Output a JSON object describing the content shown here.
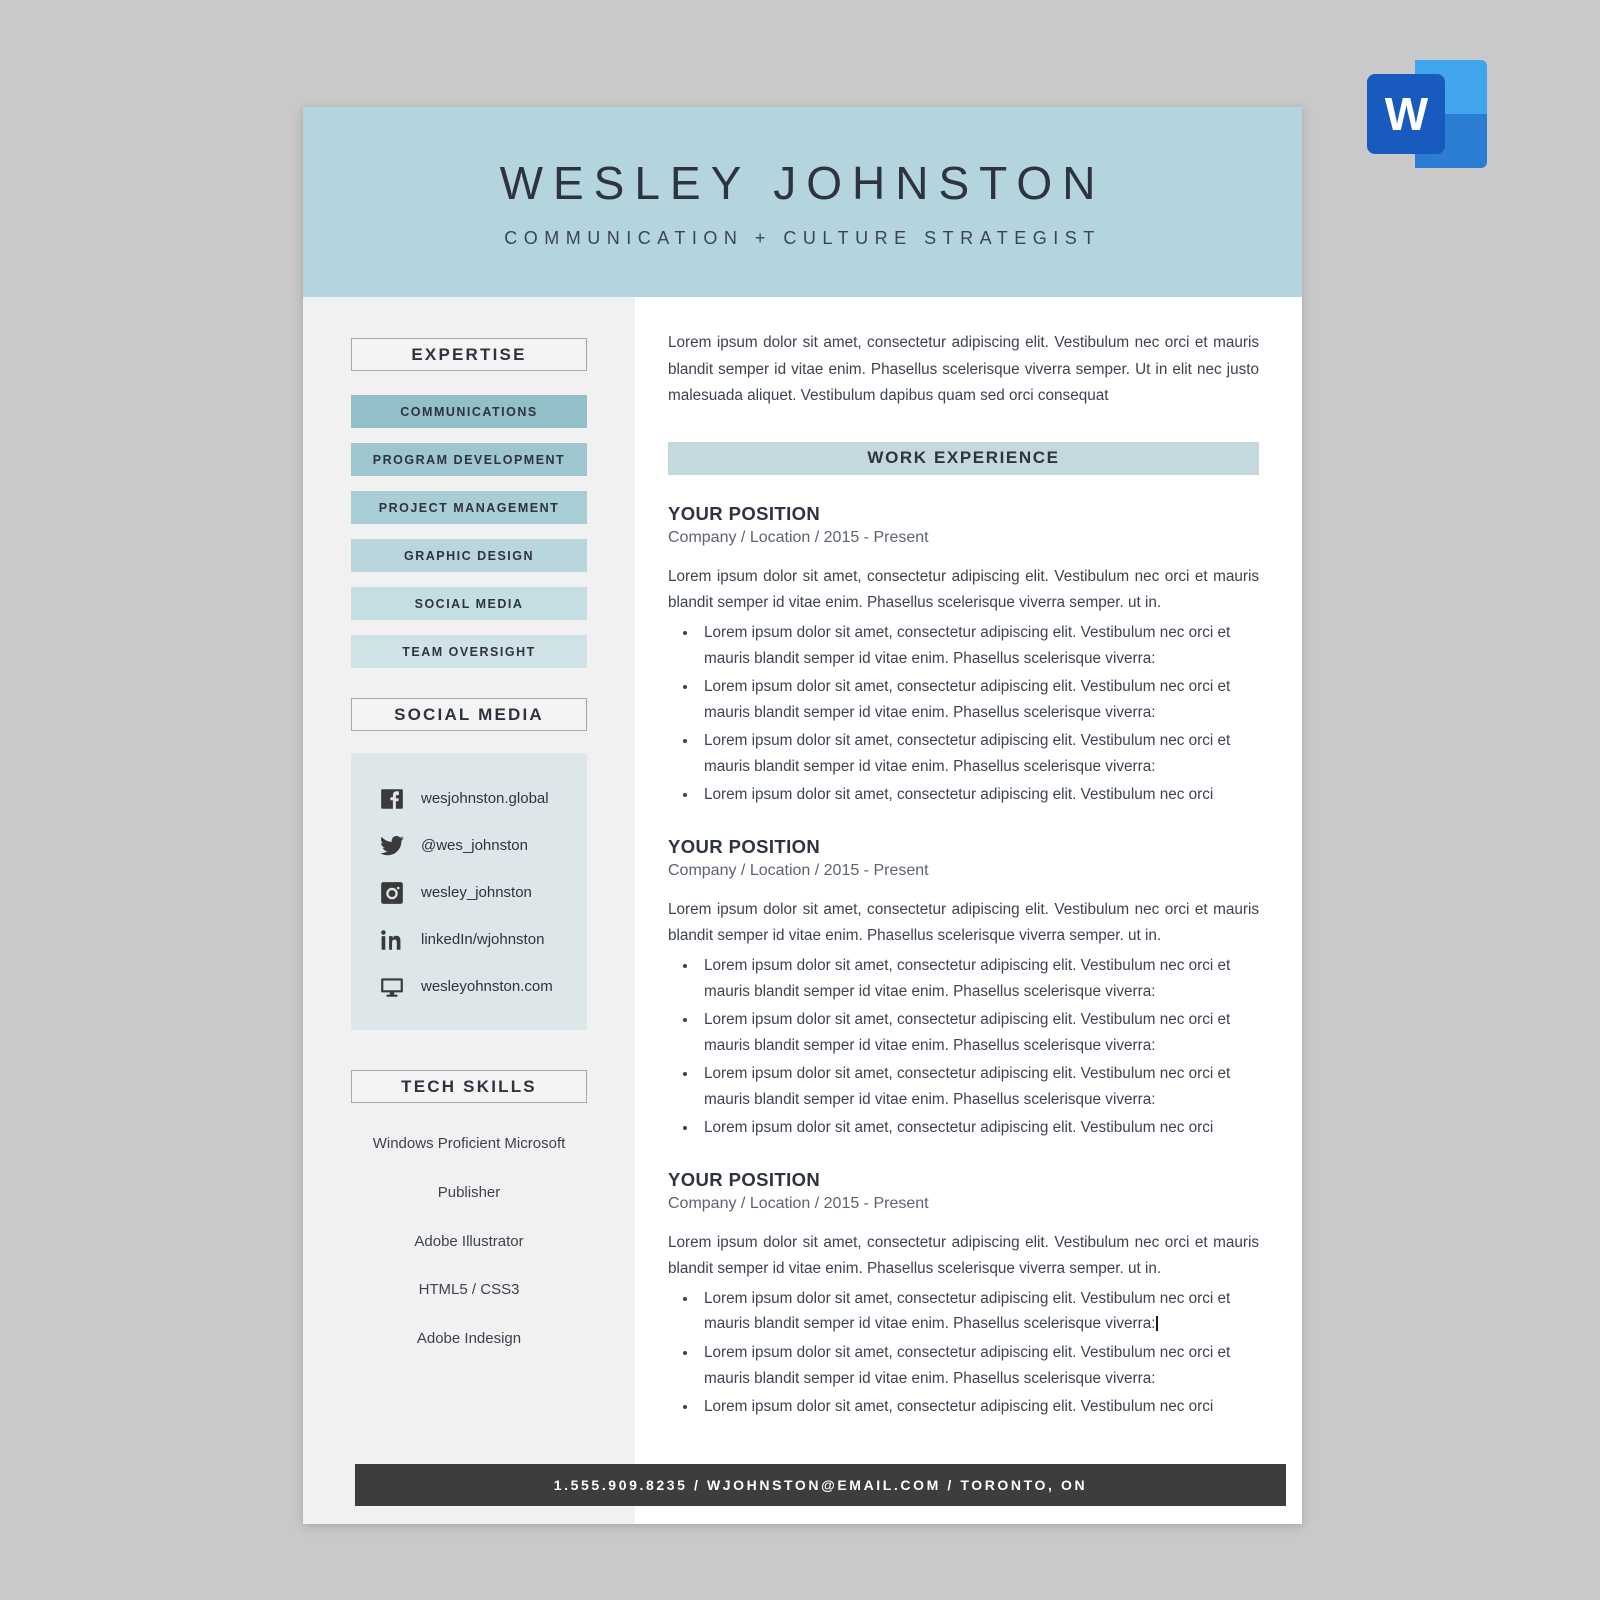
{
  "app_icon": {
    "name": "word-icon",
    "letter": "W"
  },
  "header": {
    "name": "WESLEY JOHNSTON",
    "subtitle": "COMMUNICATION + CULTURE STRATEGIST",
    "bg_color": "#b4d5dd"
  },
  "sidebar": {
    "expertise": {
      "heading": "EXPERTISE",
      "items": [
        {
          "label": "COMMUNICATIONS",
          "color": "#93bfc9"
        },
        {
          "label": "PROGRAM DEVELOPMENT",
          "color": "#9dc6cf"
        },
        {
          "label": "PROJECT MANAGEMENT",
          "color": "#a9ced5"
        },
        {
          "label": "GRAPHIC DESIGN",
          "color": "#b8d6dc"
        },
        {
          "label": "SOCIAL MEDIA",
          "color": "#c5dee3"
        },
        {
          "label": "TEAM OVERSIGHT",
          "color": "#cfe3e7"
        }
      ]
    },
    "social_media": {
      "heading": "SOCIAL MEDIA",
      "box_color": "#dde6e9",
      "items": [
        {
          "icon": "facebook-icon",
          "label": "wesjohnston.global"
        },
        {
          "icon": "twitter-icon",
          "label": "@wes_johnston"
        },
        {
          "icon": "instagram-icon",
          "label": "wesley_johnston"
        },
        {
          "icon": "linkedin-icon",
          "label": "linkedIn/wjohnston"
        },
        {
          "icon": "website-icon",
          "label": "wesleyohnston.com"
        }
      ]
    },
    "tech_skills": {
      "heading": "TECH SKILLS",
      "items": [
        "Windows Proficient Microsoft",
        "Publisher",
        "Adobe Illustrator",
        "HTML5 / CSS3",
        "Adobe Indesign"
      ]
    }
  },
  "main": {
    "intro": "Lorem ipsum dolor sit amet, consectetur adipiscing elit. Vestibulum nec orci et mauris blandit semper id vitae enim. Phasellus scelerisque viverra semper. Ut in elit nec justo malesuada aliquet. Vestibulum dapibus quam sed orci consequat",
    "work_heading": "WORK EXPERIENCE",
    "work_heading_color": "#c3d9de",
    "jobs": [
      {
        "title": "YOUR POSITION",
        "meta": "Company / Location / 2015 - Present",
        "description": "Lorem ipsum dolor sit amet, consectetur adipiscing elit. Vestibulum nec orci et mauris blandit semper id vitae enim. Phasellus scelerisque viverra semper. ut in.",
        "bullets": [
          "Lorem ipsum dolor sit amet, consectetur adipiscing elit. Vestibulum nec orci et mauris blandit semper id vitae enim. Phasellus scelerisque viverra:",
          "Lorem ipsum dolor sit amet, consectetur adipiscing elit. Vestibulum nec orci et mauris blandit semper id vitae enim. Phasellus scelerisque viverra:",
          "Lorem ipsum dolor sit amet, consectetur adipiscing elit. Vestibulum nec orci et mauris blandit semper id vitae enim. Phasellus scelerisque viverra:",
          "Lorem ipsum dolor sit amet, consectetur adipiscing elit. Vestibulum nec orci"
        ]
      },
      {
        "title": "YOUR POSITION",
        "meta": "Company / Location / 2015 - Present",
        "description": "Lorem ipsum dolor sit amet, consectetur adipiscing elit. Vestibulum nec orci et mauris blandit semper id vitae enim. Phasellus scelerisque viverra semper. ut in.",
        "bullets": [
          "Lorem ipsum dolor sit amet, consectetur adipiscing elit. Vestibulum nec orci et mauris blandit semper id vitae enim. Phasellus scelerisque viverra:",
          "Lorem ipsum dolor sit amet, consectetur adipiscing elit. Vestibulum nec orci et mauris blandit semper id vitae enim. Phasellus scelerisque viverra:",
          "Lorem ipsum dolor sit amet, consectetur adipiscing elit. Vestibulum nec orci et mauris blandit semper id vitae enim. Phasellus scelerisque viverra:",
          "Lorem ipsum dolor sit amet, consectetur adipiscing elit. Vestibulum nec orci"
        ]
      },
      {
        "title": "YOUR POSITION",
        "meta": "Company / Location / 2015 - Present",
        "description": "Lorem ipsum dolor sit amet, consectetur adipiscing elit. Vestibulum nec orci et mauris blandit semper id vitae enim. Phasellus scelerisque viverra semper. ut in.",
        "bullets": [
          "Lorem ipsum dolor sit amet, consectetur adipiscing elit. Vestibulum nec orci et mauris blandit semper id vitae enim. Phasellus scelerisque viverra:",
          "Lorem ipsum dolor sit amet, consectetur adipiscing elit. Vestibulum nec orci et mauris blandit semper id vitae enim. Phasellus scelerisque viverra:",
          "Lorem ipsum dolor sit amet, consectetur adipiscing elit. Vestibulum nec orci"
        ],
        "caret_after_bullet": 0
      }
    ]
  },
  "footer": {
    "text": "1.555.909.8235  /   WJOHNSTON@EMAIL.COM   /   TORONTO, ON",
    "bg_color": "#3d3d3d"
  }
}
